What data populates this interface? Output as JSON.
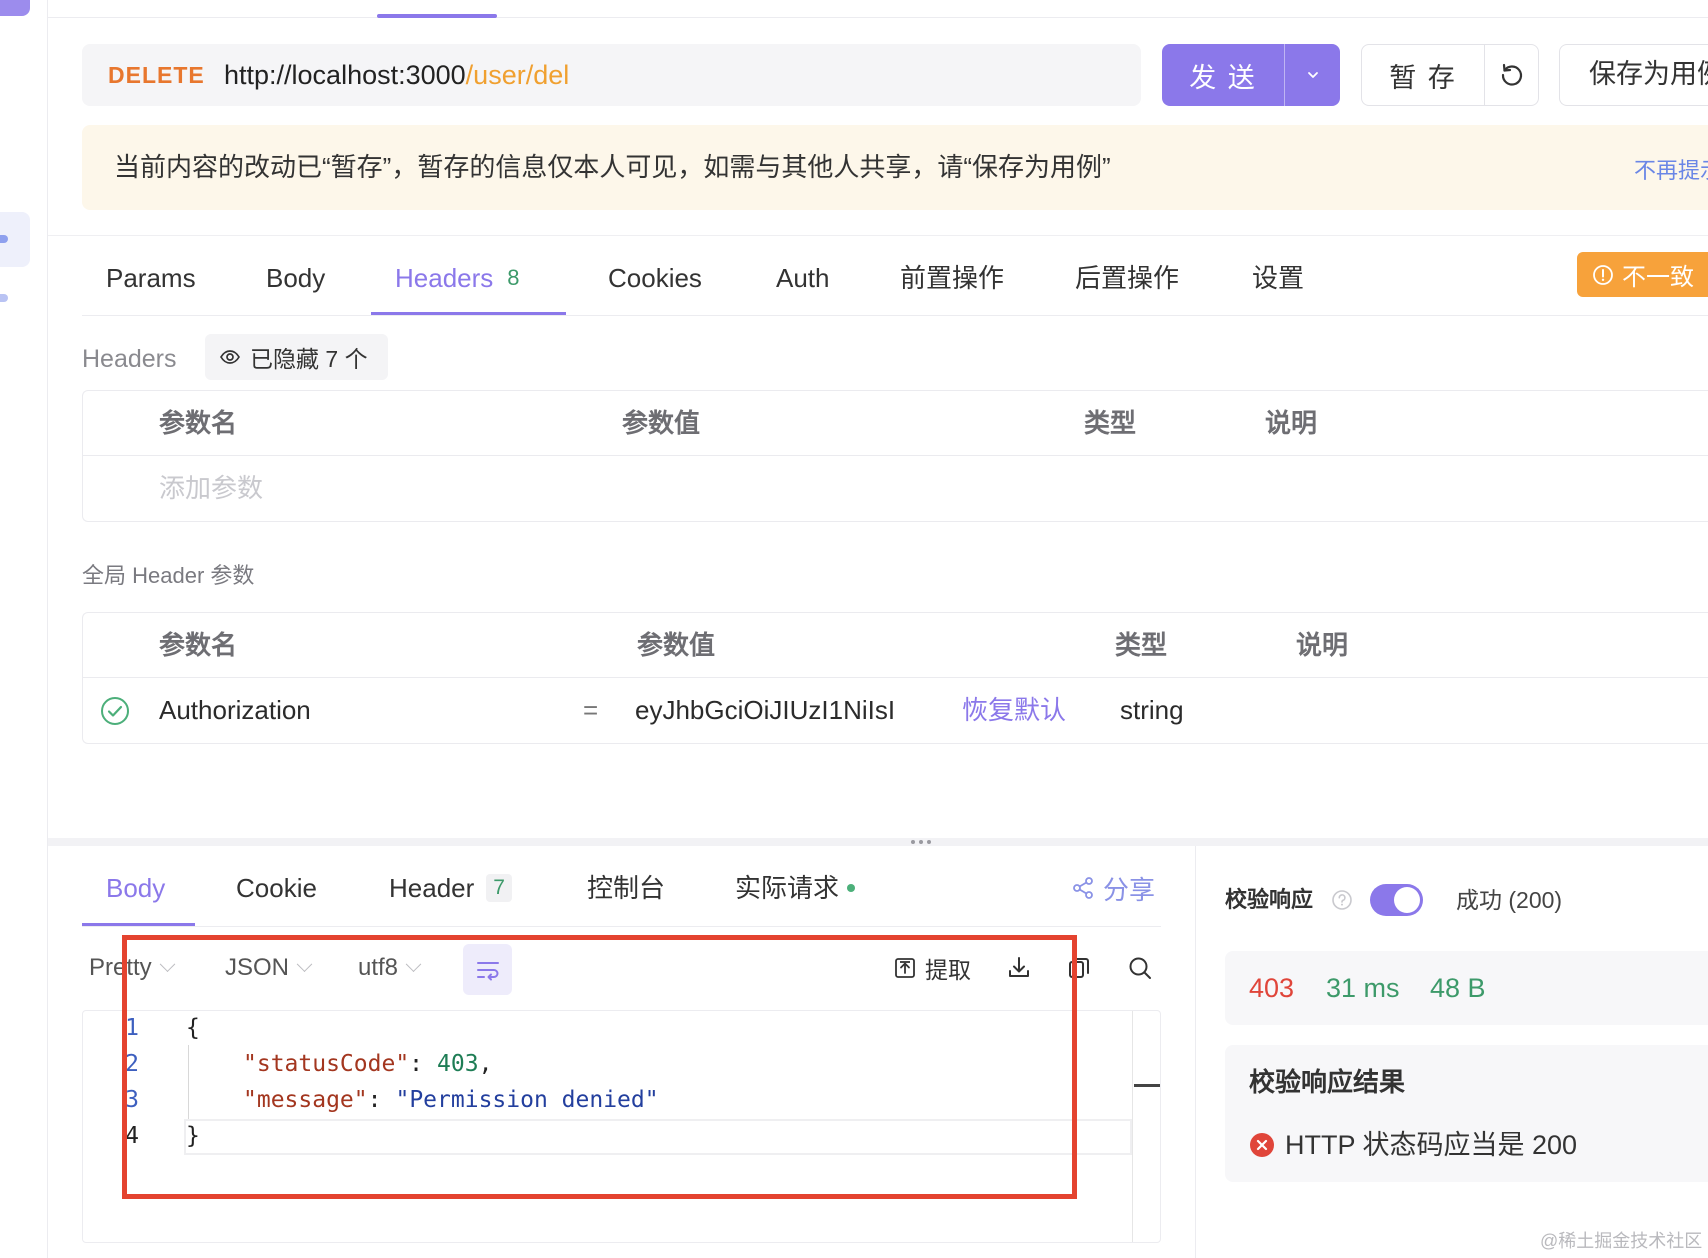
{
  "colors": {
    "accent": "#8b78ea",
    "method": "#e8772e",
    "url_path": "#f0a030",
    "notice_bg": "#fdf7ea",
    "warning": "#f7a23b",
    "success": "#3d9a6a",
    "error": "#e0453a",
    "annotation": "#e4432f"
  },
  "icons": {
    "send_options": "chevron-down-icon",
    "restore_draft": "reset-icon",
    "mismatch": "alert-circle-icon",
    "hidden_headers": "eye-icon",
    "row_enabled": "check-circle-icon",
    "share": "share-icon",
    "wrap": "word-wrap-icon",
    "extract": "extract-icon",
    "download": "download-icon",
    "copy": "copy-icon",
    "search": "search-icon",
    "help": "question-circle-icon",
    "failed": "x-circle-icon"
  },
  "request": {
    "method": "DELETE",
    "url_host": "http://localhost:3000",
    "url_path": "/user/del",
    "send_label": "发 送",
    "save_draft_label": "暂 存",
    "save_case_label": "保存为用例"
  },
  "notice": {
    "text": "当前内容的改动已“暂存”，暂存的信息仅本人可见，如需与其他人共享，请“保存为用例”",
    "dismiss_label": "不再提示"
  },
  "request_tabs": {
    "items": [
      {
        "label": "Params"
      },
      {
        "label": "Body"
      },
      {
        "label": "Headers",
        "count": "8",
        "active": true
      },
      {
        "label": "Cookies"
      },
      {
        "label": "Auth"
      },
      {
        "label": "前置操作"
      },
      {
        "label": "后置操作"
      },
      {
        "label": "设置"
      }
    ],
    "mismatch_badge": "不一致"
  },
  "headers_section": {
    "title": "Headers",
    "hidden_label": "已隐藏 7 个",
    "columns": [
      "参数名",
      "参数值",
      "类型",
      "说明"
    ],
    "add_placeholder": "添加参数"
  },
  "global_headers": {
    "title": "全局 Header 参数",
    "columns": [
      "参数名",
      "参数值",
      "类型",
      "说明"
    ],
    "rows": [
      {
        "enabled": true,
        "name": "Authorization",
        "operator": "=",
        "value": "eyJhbGciOiJIUzI1NiIsI",
        "restore_label": "恢复默认",
        "type": "string"
      }
    ]
  },
  "response": {
    "tabs": [
      {
        "label": "Body",
        "active": true
      },
      {
        "label": "Cookie"
      },
      {
        "label": "Header",
        "count": "7"
      },
      {
        "label": "控制台"
      },
      {
        "label": "实际请求",
        "live_indicator": true
      }
    ],
    "share_label": "分享",
    "toolbar": {
      "format": "Pretty",
      "language": "JSON",
      "encoding": "utf8",
      "extract_label": "提取"
    },
    "code": {
      "lines": [
        {
          "number": "1",
          "text": "{"
        },
        {
          "number": "2",
          "key": "\"statusCode\"",
          "colon": ":",
          "value": "403",
          "comma": ","
        },
        {
          "number": "3",
          "key": "\"message\"",
          "colon": ":",
          "value": "\"Permission denied\""
        },
        {
          "number": "4",
          "text": "}"
        }
      ]
    }
  },
  "validation": {
    "label": "校验响应",
    "enabled": true,
    "expected": "成功 (200)",
    "status_code": "403",
    "time": "31 ms",
    "size": "48 B",
    "result_title": "校验响应结果",
    "results": [
      {
        "passed": false,
        "text": "HTTP 状态码应当是 200"
      }
    ]
  },
  "watermark": "@稀土掘金技术社区"
}
